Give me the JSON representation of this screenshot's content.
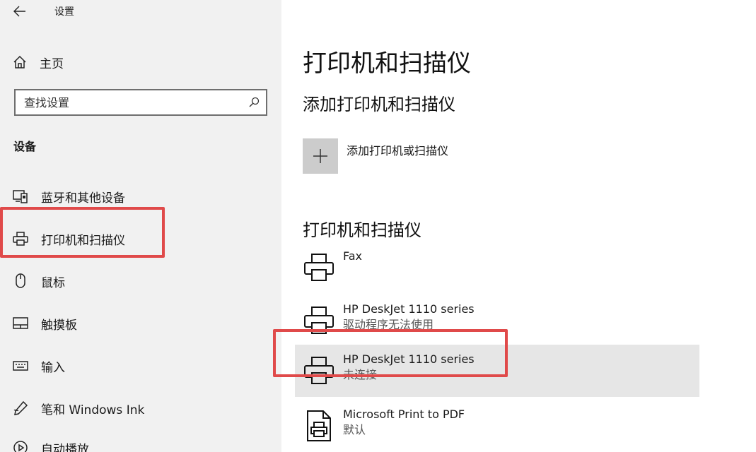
{
  "window": {
    "title": "设置"
  },
  "sidebar": {
    "home_label": "主页",
    "search_placeholder": "查找设置",
    "section_label": "设备",
    "items": [
      {
        "label": "蓝牙和其他设备",
        "icon": "bluetooth-devices-icon"
      },
      {
        "label": "打印机和扫描仪",
        "icon": "printer-icon",
        "selected": true
      },
      {
        "label": "鼠标",
        "icon": "mouse-icon"
      },
      {
        "label": "触摸板",
        "icon": "touchpad-icon"
      },
      {
        "label": "输入",
        "icon": "keyboard-icon"
      },
      {
        "label": "笔和 Windows Ink",
        "icon": "pen-icon"
      },
      {
        "label": "自动播放",
        "icon": "autoplay-icon"
      }
    ]
  },
  "main": {
    "title": "打印机和扫描仪",
    "add_section_title": "添加打印机和扫描仪",
    "add_label": "添加打印机或扫描仪",
    "list_title": "打印机和扫描仪",
    "devices": [
      {
        "name": "Fax",
        "status": "",
        "icon": "printer-icon"
      },
      {
        "name": "HP DeskJet 1110 series",
        "status": "驱动程序无法使用",
        "icon": "printer-icon"
      },
      {
        "name": "HP DeskJet 1110 series",
        "status": "未连接",
        "icon": "printer-icon",
        "selected": true
      },
      {
        "name": "Microsoft Print to PDF",
        "status": "默认",
        "icon": "pdf-printer-icon"
      }
    ]
  },
  "colors": {
    "highlight": "#e04a4a",
    "sidebar_bg": "#f1f1f1",
    "selected_bg": "#e6e6e6",
    "add_tile": "#cccccc"
  }
}
